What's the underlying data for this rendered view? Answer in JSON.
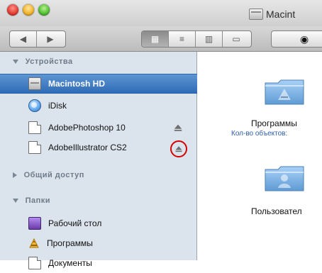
{
  "window": {
    "title": "Macintosh HD",
    "title_visible": "Macint"
  },
  "toolbar": {
    "back_icon": "chevron-left-icon",
    "forward_icon": "chevron-right-icon",
    "view_icons": [
      "icon-view-icon",
      "list-view-icon",
      "column-view-icon",
      "coverflow-view-icon"
    ],
    "quicklook_icon": "eye-icon"
  },
  "sidebar": {
    "devices_header": "Устройства",
    "devices": [
      {
        "label": "Macintosh HD",
        "icon": "hard-drive-icon",
        "selected": true
      },
      {
        "label": "iDisk",
        "icon": "idisk-icon"
      },
      {
        "label": "AdobePhotoshop 10",
        "icon": "disk-image-icon",
        "eject": true
      },
      {
        "label": "AdobeIllustrator CS2",
        "icon": "disk-image-icon",
        "eject": true,
        "eject_highlighted": true
      }
    ],
    "shared_header": "Общий доступ",
    "places_header": "Папки",
    "places": [
      {
        "label": "Рабочий стол",
        "icon": "desktop-icon"
      },
      {
        "label": "Программы",
        "icon": "applications-icon"
      },
      {
        "label": "Документы",
        "icon": "documents-icon"
      }
    ]
  },
  "content": {
    "items": [
      {
        "title": "Программы",
        "subtitle": "Кол-во объектов:",
        "icon": "applications-folder-icon"
      },
      {
        "title": "Пользовател",
        "icon": "users-folder-icon"
      }
    ]
  },
  "colors": {
    "sidebar_bg": "#dbe3ec",
    "selection": "#2f6cb6",
    "highlight_ring": "#d40000",
    "folder_blue": "#78aee1"
  }
}
